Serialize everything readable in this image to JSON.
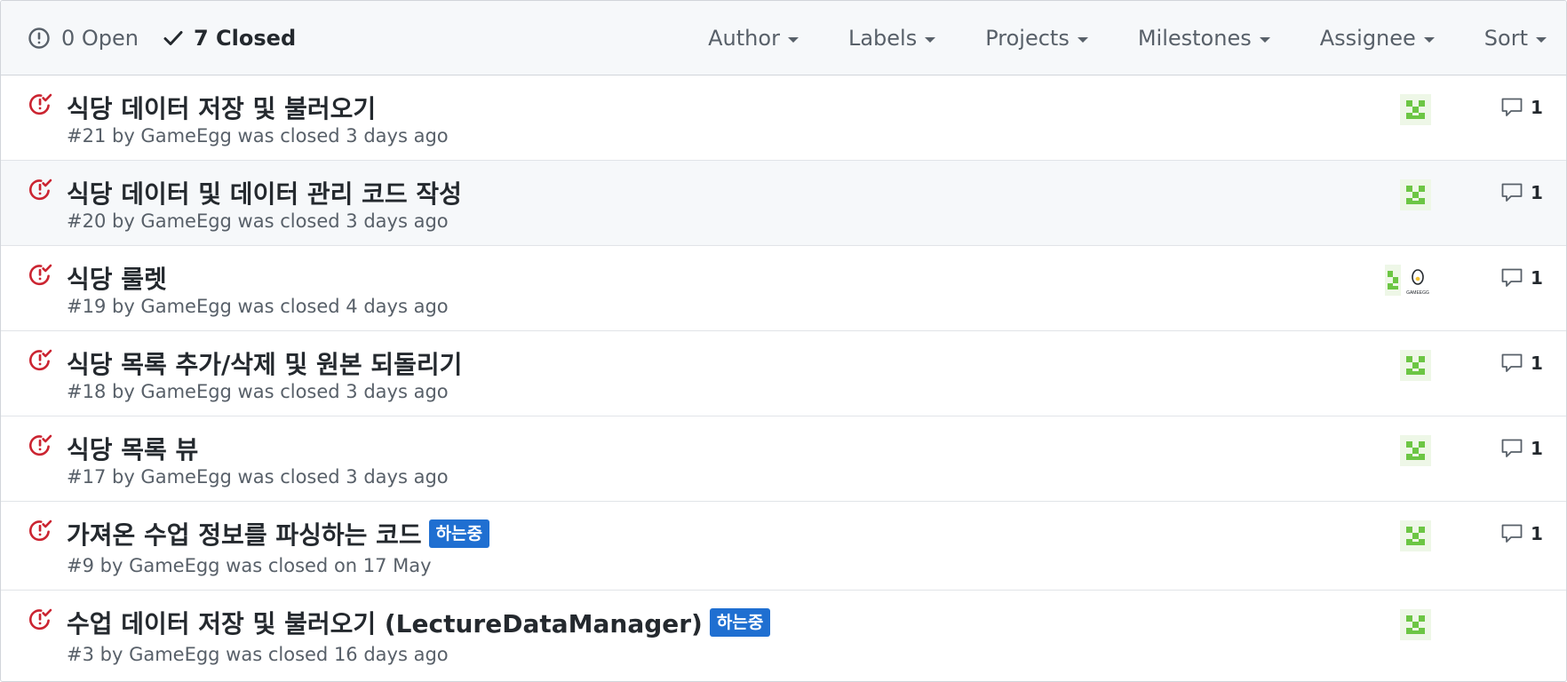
{
  "states": {
    "open_label": "0 Open",
    "closed_label": "7 Closed"
  },
  "filters": {
    "author": "Author",
    "labels": "Labels",
    "projects": "Projects",
    "milestones": "Milestones",
    "assignee": "Assignee",
    "sort": "Sort"
  },
  "issues": [
    {
      "title": "식당 데이터 저장 및 불러오기",
      "meta": "#21 by GameEgg was closed 3 days ago",
      "comments": "1"
    },
    {
      "title": "식당 데이터 및 데이터 관리 코드 작성",
      "meta": "#20 by GameEgg was closed 3 days ago",
      "comments": "1"
    },
    {
      "title": "식당 룰렛",
      "meta": "#19 by GameEgg was closed 4 days ago",
      "comments": "1",
      "egg_text": "GAMEEGG"
    },
    {
      "title": "식당 목록 추가/삭제 및 원본 되돌리기",
      "meta": "#18 by GameEgg was closed 3 days ago",
      "comments": "1"
    },
    {
      "title": "식당 목록 뷰",
      "meta": "#17 by GameEgg was closed 3 days ago",
      "comments": "1"
    },
    {
      "title": "가져온 수업 정보를 파싱하는 코드",
      "label": "하는중",
      "meta": "#9 by GameEgg was closed on 17 May",
      "comments": "1"
    },
    {
      "title": "수업 데이터 저장 및 불러오기 (LectureDataManager)",
      "label": "하는중",
      "meta": "#3 by GameEgg was closed 16 days ago"
    }
  ],
  "colors": {
    "closed_icon": "#cb2431",
    "label_bg": "#1f6fd1",
    "avatar_green": "#6cc644",
    "header_bg": "#f6f8fa"
  },
  "icons": {
    "open": "issue-opened-icon",
    "closed_check": "check-icon",
    "issue_closed": "issue-closed-icon",
    "comment": "comment-icon",
    "caret": "caret-down-icon"
  }
}
